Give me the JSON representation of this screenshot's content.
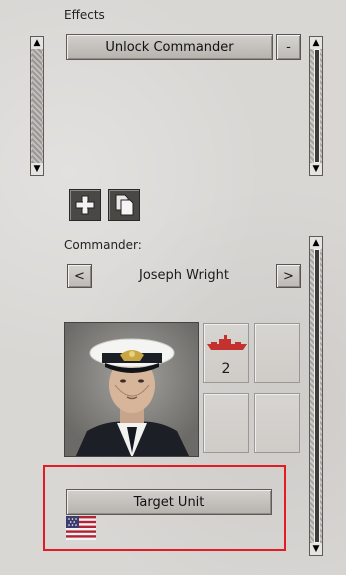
{
  "effects": {
    "heading": "Effects",
    "unlock_commander_label": "Unlock Commander",
    "remove_label": "-"
  },
  "toolbar": {
    "add_icon": "plus-icon",
    "copy_icon": "copy-icon"
  },
  "commander": {
    "heading": "Commander:",
    "prev_label": "<",
    "next_label": ">",
    "name": "Joseph Wright",
    "unit_slots": [
      {
        "icon": "warship-icon",
        "count": "2"
      },
      {
        "icon": "",
        "count": ""
      },
      {
        "icon": "",
        "count": ""
      },
      {
        "icon": "",
        "count": ""
      }
    ]
  },
  "target": {
    "button_label": "Target Unit",
    "flag": "usa-flag"
  },
  "colors": {
    "highlight_border": "#e31b23"
  }
}
